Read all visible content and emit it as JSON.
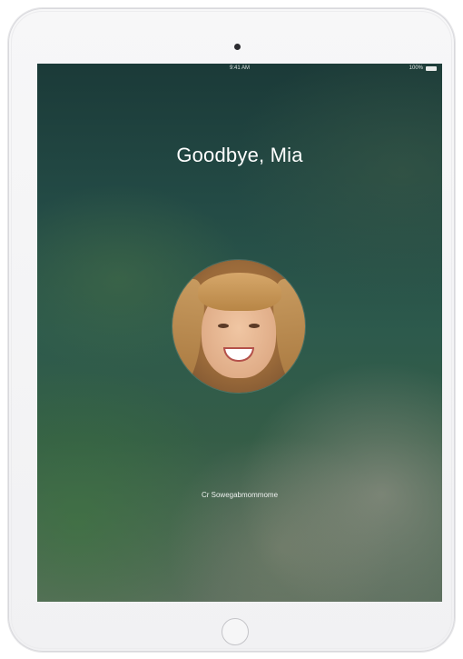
{
  "status_bar": {
    "time": "9:41 AM",
    "battery_percent": "100%"
  },
  "lock_screen": {
    "greeting": "Goodbye, Mia",
    "unlock_hint": "Cr Sowegabmommome"
  },
  "colors": {
    "device_frame": "#f4f4f6",
    "greeting_text": "#ffffff",
    "wallpaper_top": "#1b3a38",
    "wallpaper_bottom": "#5a6e5d"
  },
  "icons": {
    "camera": "front-camera-icon",
    "home": "home-button-icon",
    "battery": "battery-icon"
  }
}
